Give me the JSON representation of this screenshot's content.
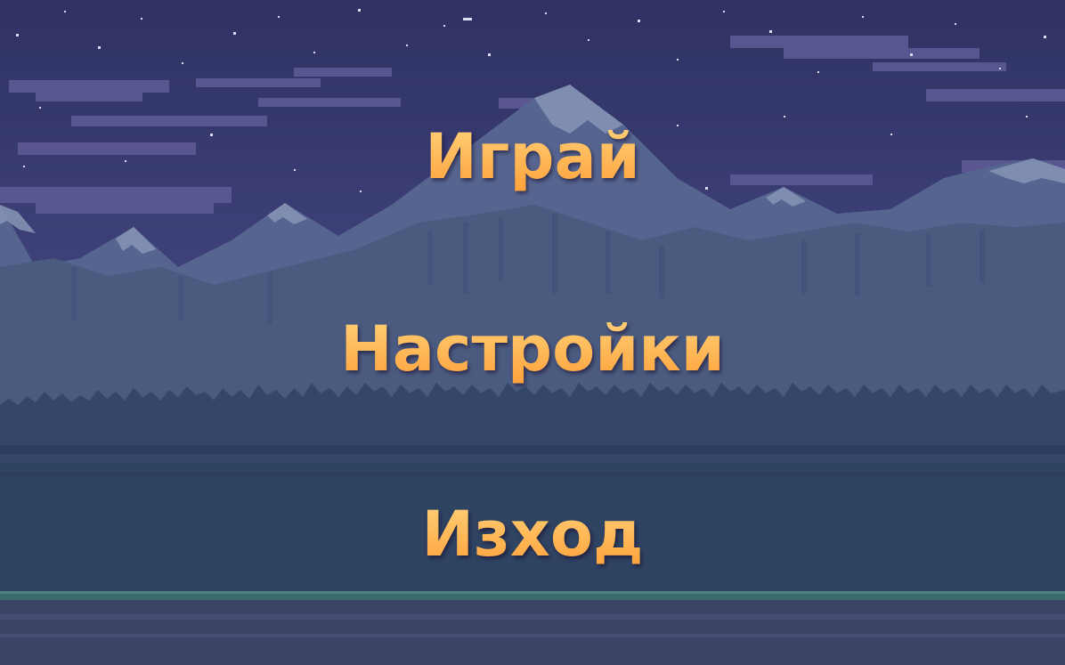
{
  "menu": {
    "play_label": "Играй",
    "settings_label": "Настройки",
    "exit_label": "Изход"
  },
  "colors": {
    "sky": "#35386a",
    "sky_horizon": "#4a4f86",
    "clouds": "#6e6ba8",
    "mountains_far": "#5a6a92",
    "mountains_near": "#4c5d80",
    "snow": "#8a96b8",
    "forest": "#34486a",
    "ground": "#2f4563",
    "grass": "#3a6a6a",
    "menu_text": "#ffb347"
  }
}
